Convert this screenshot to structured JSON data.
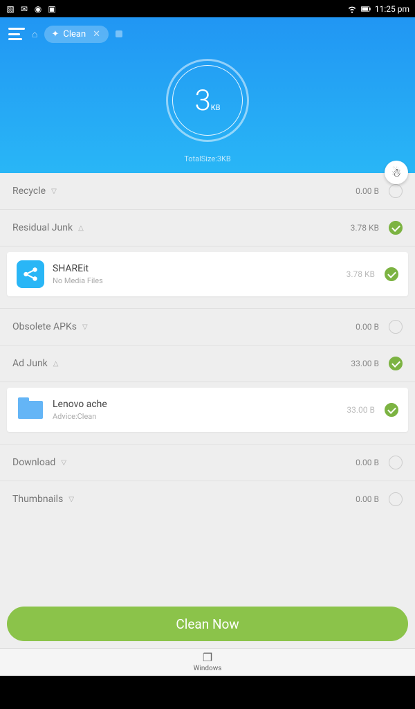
{
  "status": {
    "time": "11:25 pm"
  },
  "tab": {
    "label": "Clean"
  },
  "ring": {
    "value": "3",
    "unit": "KB"
  },
  "total": {
    "label": "TotalSize:3KB"
  },
  "rows": {
    "recycle": {
      "label": "Recycle",
      "size": "0.00 B"
    },
    "residual": {
      "label": "Residual Junk",
      "size": "3.78 KB"
    },
    "obsolete": {
      "label": "Obsolete APKs",
      "size": "0.00 B"
    },
    "adjunk": {
      "label": "Ad Junk",
      "size": "33.00 B"
    },
    "download": {
      "label": "Download",
      "size": "0.00 B"
    },
    "thumbnails": {
      "label": "Thumbnails",
      "size": "0.00 B"
    }
  },
  "items": {
    "shareit": {
      "title": "SHAREit",
      "sub": "No Media Files",
      "size": "3.78 KB"
    },
    "lenovo": {
      "title": "Lenovo ache",
      "sub": "Advice:Clean",
      "size": "33.00 B"
    }
  },
  "clean_btn": "Clean Now",
  "windows": {
    "label": "Windows"
  }
}
